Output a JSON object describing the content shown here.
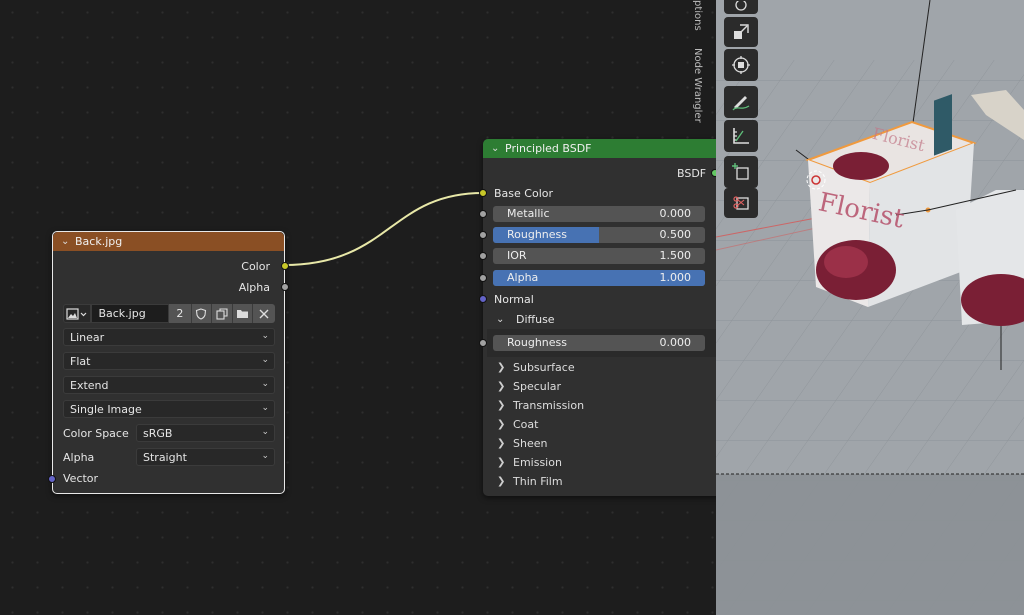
{
  "image_node": {
    "title": "Back.jpg",
    "header_color": "#8a4f24",
    "outputs": [
      "Color",
      "Alpha"
    ],
    "image_name": "Back.jpg",
    "user_count": "2",
    "interpolation": "Linear",
    "projection": "Flat",
    "extension": "Extend",
    "source": "Single Image",
    "color_space_label": "Color Space",
    "color_space": "sRGB",
    "alpha_label": "Alpha",
    "alpha_mode": "Straight",
    "vector_label": "Vector"
  },
  "bsdf_node": {
    "title": "Principled BSDF",
    "header_color": "#2d7d33",
    "output": "BSDF",
    "base_color": "Base Color",
    "metallic": {
      "label": "Metallic",
      "value": "0.000",
      "fraction": 0
    },
    "roughness": {
      "label": "Roughness",
      "value": "0.500",
      "fraction": 0.5
    },
    "ior": {
      "label": "IOR",
      "value": "1.500",
      "fraction": 0
    },
    "alpha": {
      "label": "Alpha",
      "value": "1.000",
      "fraction": 1
    },
    "normal": "Normal",
    "diffuse_label": "Diffuse",
    "diffuse_roughness": {
      "label": "Roughness",
      "value": "0.000",
      "fraction": 0
    },
    "panels": [
      "Subsurface",
      "Specular",
      "Transmission",
      "Coat",
      "Sheen",
      "Emission",
      "Thin Film"
    ]
  },
  "sidebar_tabs": {
    "options": "ptions",
    "node_wrangler": "Node Wrangler"
  },
  "viewport": {
    "box_text": "Florist",
    "box_text_top": "Florist"
  },
  "icons": [
    "image-browse-icon",
    "fake-user-shield-icon",
    "duplicate-icon",
    "folder-open-icon",
    "unlink-x-icon",
    "rotate-icon",
    "scale-icon",
    "transform-icon",
    "annotate-icon",
    "measure-icon",
    "add-cube-icon",
    "cut-cube-icon"
  ]
}
